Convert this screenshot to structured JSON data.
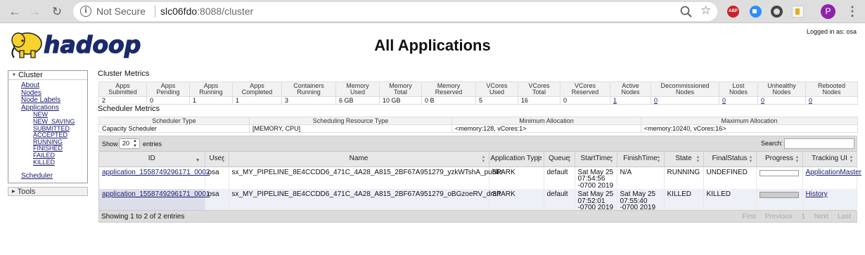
{
  "browser": {
    "security_text": "Not Secure",
    "url_host": "slc06fdo",
    "url_rest": ":8088/cluster",
    "extensions": [
      "ABP",
      "zoom",
      "circle",
      "note"
    ],
    "avatar_letter": "P"
  },
  "header": {
    "logo_text": "hadoop",
    "title": "All Applications",
    "logged_in": "Logged in as: osa"
  },
  "nav": {
    "cluster_label": "Cluster",
    "links": [
      "About",
      "Nodes",
      "Node Labels",
      "Applications"
    ],
    "app_states": [
      "NEW",
      "NEW_SAVING",
      "SUBMITTED",
      "ACCEPTED",
      "RUNNING",
      "FINISHED",
      "FAILED",
      "KILLED"
    ],
    "scheduler_label": "Scheduler",
    "tools_label": "Tools"
  },
  "cluster_metrics": {
    "title": "Cluster Metrics",
    "headers": [
      [
        "Apps",
        "Submitted"
      ],
      [
        "Apps",
        "Pending"
      ],
      [
        "Apps",
        "Running"
      ],
      [
        "Apps",
        "Completed"
      ],
      [
        "Containers",
        "Running"
      ],
      [
        "Memory",
        "Used"
      ],
      [
        "Memory",
        "Total"
      ],
      [
        "Memory",
        "Reserved"
      ],
      [
        "VCores",
        "Used"
      ],
      [
        "VCores",
        "Total"
      ],
      [
        "VCores",
        "Reserved"
      ],
      [
        "Active",
        "Nodes"
      ],
      [
        "Decommissioned",
        "Nodes"
      ],
      [
        "Lost",
        "Nodes"
      ],
      [
        "Unhealthy",
        "Nodes"
      ],
      [
        "Rebooted",
        "Nodes"
      ]
    ],
    "values": [
      "2",
      "0",
      "1",
      "1",
      "3",
      "6 GB",
      "10 GB",
      "0 B",
      "5",
      "16",
      "0",
      "1",
      "0",
      "0",
      "0",
      "0"
    ],
    "linked": [
      false,
      false,
      false,
      false,
      false,
      false,
      false,
      false,
      false,
      false,
      false,
      true,
      true,
      true,
      true,
      true
    ]
  },
  "scheduler_metrics": {
    "title": "Scheduler Metrics",
    "headers": [
      "Scheduler Type",
      "Scheduling Resource Type",
      "Minimum Allocation",
      "Maximum Allocation"
    ],
    "values": [
      "Capacity Scheduler",
      "[MEMORY, CPU]",
      "<memory:128, vCores:1>",
      "<memory:10240, vCores:16>"
    ]
  },
  "apps_table": {
    "show_label": "Show",
    "entries_value": "20",
    "entries_label": "entries",
    "search_label": "Search:",
    "search_value": "",
    "headers": [
      "ID",
      "User",
      "Name",
      "Application Type",
      "Queue",
      "StartTime",
      "FinishTime",
      "State",
      "FinalStatus",
      "Progress",
      "Tracking UI"
    ],
    "rows": [
      {
        "id": "application_1558749296171_0002",
        "user": "osa",
        "name": "sx_MY_PIPELINE_8E4CCDD6_471C_4A28_A815_2BF67A951279_yzkWTshA_public",
        "type": "SPARK",
        "queue": "default",
        "start": [
          "Sat May 25",
          "07:54:56",
          "-0700 2019"
        ],
        "finish": [
          "N/A"
        ],
        "state": "RUNNING",
        "final_status": "UNDEFINED",
        "progress": 0.0,
        "tracking": "ApplicationMaster"
      },
      {
        "id": "application_1558749296171_0001",
        "user": "osa",
        "name": "sx_MY_PIPELINE_8E4CCDD6_471C_4A28_A815_2BF67A951279_oBGzoeRV_draft",
        "type": "SPARK",
        "queue": "default",
        "start": [
          "Sat May 25",
          "07:52:01",
          "-0700 2019"
        ],
        "finish": [
          "Sat May 25",
          "07:55:40",
          "-0700 2019"
        ],
        "state": "KILLED",
        "final_status": "KILLED",
        "progress": 1.0,
        "tracking": "History"
      }
    ],
    "info": "Showing 1 to 2 of 2 entries",
    "pager": [
      "First",
      "Previous",
      "1",
      "Next",
      "Last"
    ]
  }
}
